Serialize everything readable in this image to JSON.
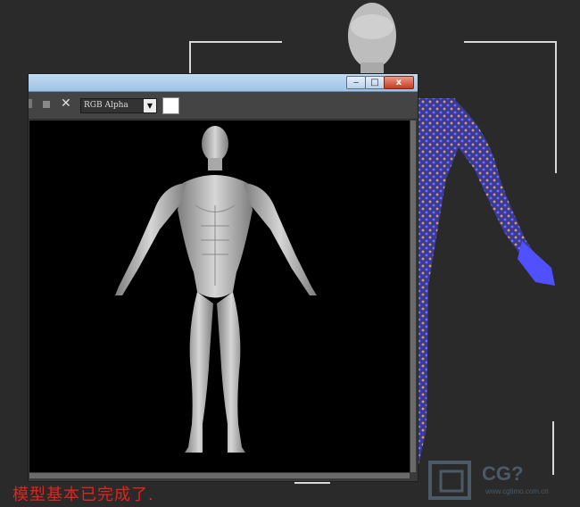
{
  "window": {
    "title_buttons": {
      "minimize": "‒",
      "maximize": "□",
      "close": "x"
    }
  },
  "toolbar": {
    "channel_value": "RGB Alpha",
    "channel_dropdown_icon": "triangle-down-icon",
    "clear_icon": "x-icon"
  },
  "caption": "模型基本已完成了.",
  "watermark": {
    "brand": "CG?",
    "url": "www.cgtimo.com.cn"
  },
  "colors": {
    "viewport_bg": "#2a2a2a",
    "render_bg": "#000000",
    "titlebar": "#a8cbeb",
    "close_button": "#c63b22",
    "caption": "#e4231b",
    "wireframe_blue": "#5a5aff",
    "wireframe_orange": "#e0a040"
  }
}
